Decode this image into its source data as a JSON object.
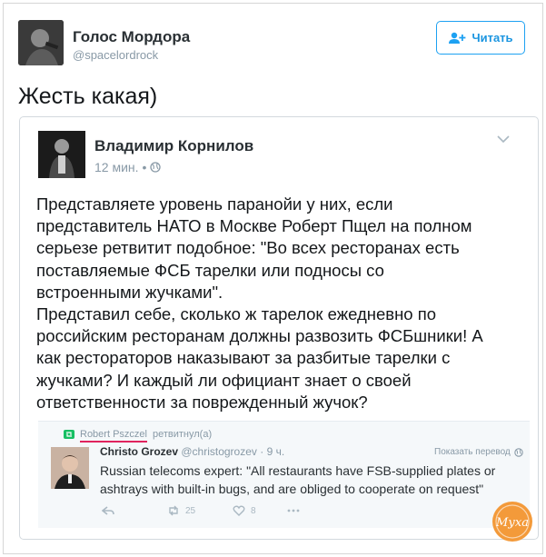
{
  "header": {
    "author_name": "Голос Мордора",
    "author_handle": "@spacelordrock",
    "follow_label": "Читать"
  },
  "tweet": {
    "text": "Жесть какая)"
  },
  "quoted": {
    "author_name": "Владимир Корнилов",
    "time": "12 мин.",
    "separator": "•",
    "lines": [
      "Представляете уровень паранойи у них, если",
      "представитель НАТО в Москве Роберт Пщел на полном",
      "серьезе ретвитит подобное: \"Во всех ресторанах есть",
      "поставляемые ФСБ тарелки или подносы со",
      "встроенными жучками\".",
      "Представил себе, сколько ж тарелок ежедневно по",
      "российским ресторанам должны развозить ФСБшники! А",
      "как рестораторов наказывают за разбитые тарелки с",
      "жучками? И каждый ли официант знает о своей",
      "ответственности за поврежденный жучок?"
    ],
    "embed": {
      "retweeted_by": "Robert Pszczel",
      "retweeted_label": "ретвитнул(а)",
      "author_name": "Christo Grozev",
      "author_handle": "@christogrozev",
      "time": "· 9 ч.",
      "translate_label": "Показать перевод",
      "lines": [
        "Russian telecoms expert: \"All restaurants have FSB-supplied plates or",
        "ashtrays with built-in bugs, and are obliged to cooperate on request\""
      ],
      "retweet_count": "25",
      "like_count": "8"
    }
  },
  "watermark": {
    "text": "Муха"
  },
  "colors": {
    "accent": "#1da1f2",
    "retweet_green": "#17bf63",
    "underline_red": "#e0245e",
    "muted": "#8899a6"
  }
}
